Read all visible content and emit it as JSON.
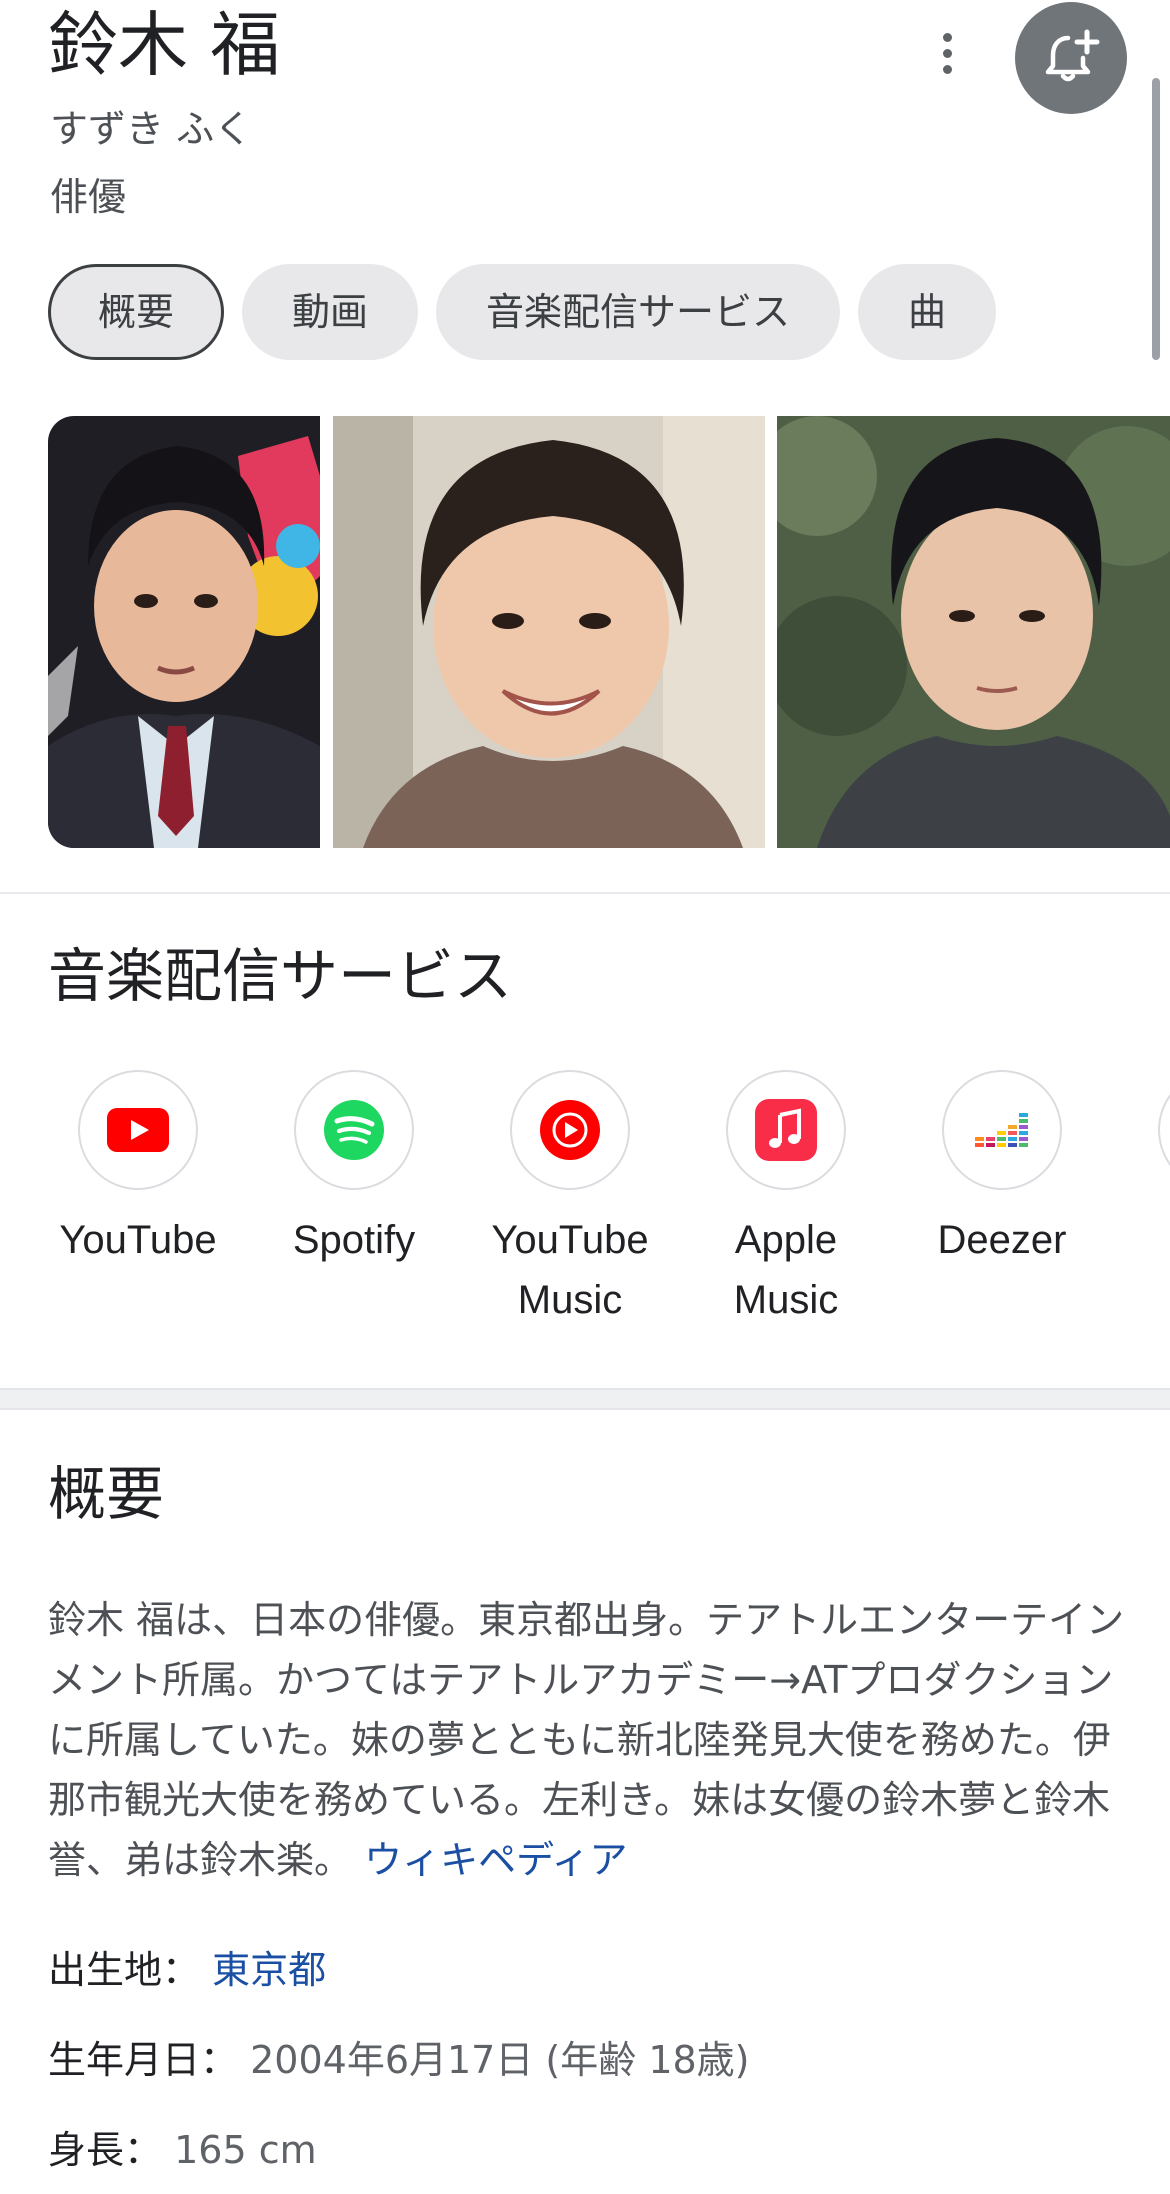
{
  "header": {
    "title": "鈴木 福",
    "reading": "すずき ふく",
    "subtitle": "俳優"
  },
  "tabs": [
    {
      "label": "概要",
      "active": true
    },
    {
      "label": "動画",
      "active": false
    },
    {
      "label": "音楽配信サービス",
      "active": false
    },
    {
      "label": "曲",
      "active": false
    }
  ],
  "streaming": {
    "title": "音楽配信サービス",
    "services": [
      {
        "name": "YouTube",
        "icon": "youtube-icon"
      },
      {
        "name": "Spotify",
        "icon": "spotify-icon"
      },
      {
        "name": "YouTube Music",
        "icon": "youtube-music-icon"
      },
      {
        "name": "Apple Music",
        "icon": "apple-music-icon"
      },
      {
        "name": "Deezer",
        "icon": "deezer-icon"
      }
    ]
  },
  "overview": {
    "title": "概要",
    "description": "鈴木 福は、日本の俳優。東京都出身。テアトルエンターテインメント所属。かつてはテアトルアカデミー→ATプロダクションに所属していた。妹の夢とともに新北陸発見大使を務めた。伊那市観光大使を務めている。左利き。妹は女優の鈴木夢と鈴木誉、弟は鈴木楽。",
    "source_link": "ウィキペディア",
    "facts": [
      {
        "label": "出生地：",
        "value": "東京都",
        "is_link": true
      },
      {
        "label": "生年月日：",
        "value": "2004年6月17日 (年齢 18歳)",
        "is_link": false
      },
      {
        "label": "身長：",
        "value": "165 cm",
        "is_link": false
      }
    ]
  },
  "colors": {
    "link": "#1a4fa3",
    "youtube_red": "#ff0000",
    "spotify_green": "#1ed760",
    "apple_music": "#fa2d48",
    "bell_button_bg": "#70757a"
  }
}
